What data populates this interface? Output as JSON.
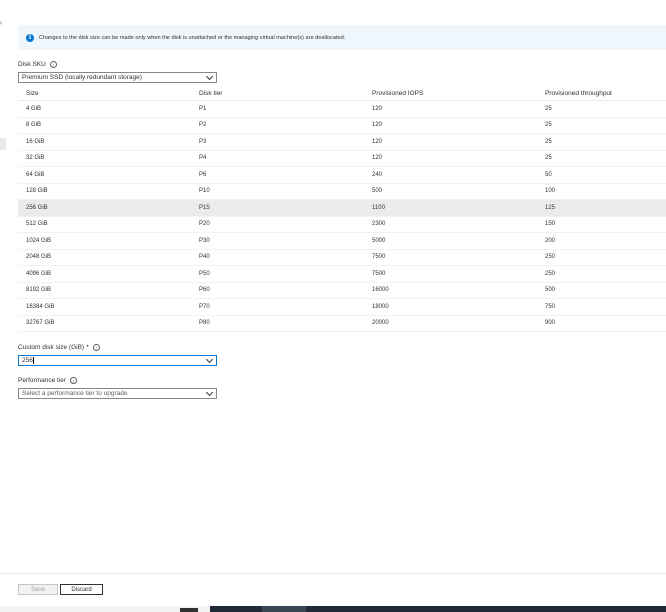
{
  "info": {
    "icon": "info-icon",
    "message": "Changes to the disk size can be made only when the disk is unattached or the managing virtual machine(s) are deallocated."
  },
  "disk_sku": {
    "label": "Disk SKU",
    "value": "Premium SSD (locally redundant storage)"
  },
  "table": {
    "headers": {
      "size": "Size",
      "tier": "Disk tier",
      "iops": "Provisioned IOPS",
      "throughput": "Provisioned throughput"
    },
    "rows": [
      {
        "size": "4 GiB",
        "tier": "P1",
        "iops": "120",
        "throughput": "25"
      },
      {
        "size": "8 GiB",
        "tier": "P2",
        "iops": "120",
        "throughput": "25"
      },
      {
        "size": "16 GiB",
        "tier": "P3",
        "iops": "120",
        "throughput": "25"
      },
      {
        "size": "32 GiB",
        "tier": "P4",
        "iops": "120",
        "throughput": "25"
      },
      {
        "size": "64 GiB",
        "tier": "P6",
        "iops": "240",
        "throughput": "50"
      },
      {
        "size": "128 GiB",
        "tier": "P10",
        "iops": "500",
        "throughput": "100"
      },
      {
        "size": "256 GiB",
        "tier": "P15",
        "iops": "1100",
        "throughput": "125"
      },
      {
        "size": "512 GiB",
        "tier": "P20",
        "iops": "2300",
        "throughput": "150"
      },
      {
        "size": "1024 GiB",
        "tier": "P30",
        "iops": "5000",
        "throughput": "200"
      },
      {
        "size": "2048 GiB",
        "tier": "P40",
        "iops": "7500",
        "throughput": "250"
      },
      {
        "size": "4096 GiB",
        "tier": "P50",
        "iops": "7500",
        "throughput": "250"
      },
      {
        "size": "8192 GiB",
        "tier": "P60",
        "iops": "16000",
        "throughput": "500"
      },
      {
        "size": "16384 GiB",
        "tier": "P70",
        "iops": "18000",
        "throughput": "750"
      },
      {
        "size": "32767 GiB",
        "tier": "P80",
        "iops": "20000",
        "throughput": "900"
      }
    ],
    "selected_index": 6
  },
  "custom_size": {
    "label": "Custom disk size (GiB)",
    "required_marker": "*",
    "value": "256"
  },
  "performance_tier": {
    "label": "Performance tier",
    "placeholder": "Select a performance tier to upgrade"
  },
  "footer": {
    "save_label": "Save",
    "discard_label": "Discard"
  }
}
